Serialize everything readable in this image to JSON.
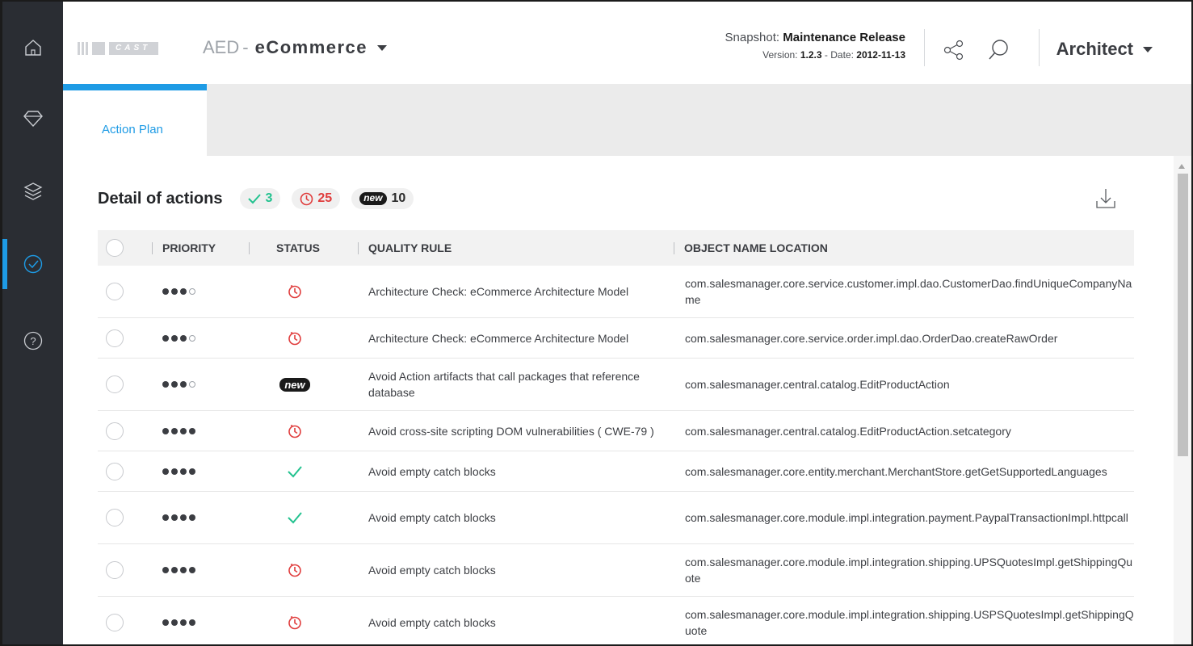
{
  "sidebar": {
    "items": [
      {
        "name": "home-icon",
        "active": false
      },
      {
        "name": "diamond-icon",
        "active": false
      },
      {
        "name": "layers-icon",
        "active": false
      },
      {
        "name": "check-circle-icon",
        "active": true
      },
      {
        "name": "help-icon",
        "active": false
      }
    ],
    "accent_color": "#1e9be5"
  },
  "header": {
    "logo_text": "CAST",
    "app_prefix": "AED",
    "app_separator": "-",
    "app_name": "eCommerce",
    "snapshot_label": "Snapshot:",
    "snapshot_name": "Maintenance Release",
    "version_label": "Version:",
    "version_value": "1.2.3",
    "date_label": "- Date:",
    "date_value": "2012-11-13",
    "share_icon": "share-icon",
    "search_icon": "search-icon",
    "role": "Architect"
  },
  "tabs": [
    {
      "label": "Action Plan",
      "active": true
    }
  ],
  "main": {
    "title": "Detail of actions",
    "badges": {
      "done_count": "3",
      "pending_count": "25",
      "new_label": "new",
      "new_count": "10"
    },
    "download_icon": "download-icon",
    "columns": {
      "priority": "PRIORITY",
      "status": "STATUS",
      "rule": "QUALITY RULE",
      "object": "OBJECT NAME LOCATION"
    },
    "rows": [
      {
        "priority": 3,
        "status": "pending",
        "rule": "Architecture Check: eCommerce Architecture Model",
        "object": "com.salesmanager.core.service.customer.impl.dao.CustomerDao.findUniqueCompanyName"
      },
      {
        "priority": 3,
        "status": "pending",
        "rule": "Architecture Check: eCommerce Architecture Model",
        "object": "com.salesmanager.core.service.order.impl.dao.OrderDao.createRawOrder"
      },
      {
        "priority": 3,
        "status": "new",
        "rule": "Avoid Action artifacts that call packages that reference database",
        "object": "com.salesmanager.central.catalog.EditProductAction"
      },
      {
        "priority": 4,
        "status": "pending",
        "rule": "Avoid cross-site scripting DOM vulnerabilities ( CWE-79 )",
        "object": "com.salesmanager.central.catalog.EditProductAction.setcategory"
      },
      {
        "priority": 4,
        "status": "done",
        "rule": "Avoid empty catch blocks",
        "object": "com.salesmanager.core.entity.merchant.MerchantStore.getGetSupportedLanguages"
      },
      {
        "priority": 4,
        "status": "done",
        "rule": "Avoid empty catch blocks",
        "object": "com.salesmanager.core.module.impl.integration.payment.PaypalTransactionImpl.httpcall"
      },
      {
        "priority": 4,
        "status": "pending",
        "rule": "Avoid empty catch blocks",
        "object": "com.salesmanager.core.module.impl.integration.shipping.UPSQuotesImpl.getShippingQuote"
      },
      {
        "priority": 4,
        "status": "pending",
        "rule": "Avoid empty catch blocks",
        "object": "com.salesmanager.core.module.impl.integration.shipping.USPSQuotesImpl.getShippingQuote"
      }
    ],
    "colors": {
      "done": "#23c28f",
      "pending": "#e03d3d",
      "new": "#1a1a1a"
    }
  }
}
